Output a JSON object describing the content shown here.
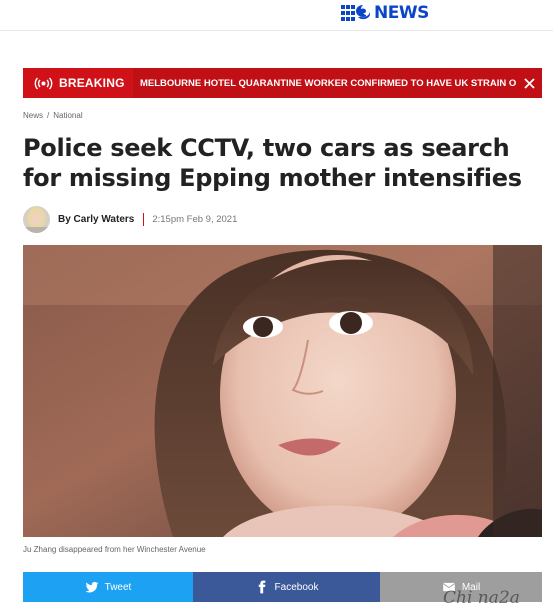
{
  "brand": {
    "logo_text": "NEWS",
    "primary_color": "#0b46c9"
  },
  "breaking": {
    "label": "BREAKING",
    "message": "MELBOURNE HOTEL QUARANTINE WORKER CONFIRMED TO HAVE UK STRAIN OF ...",
    "color": "#d01218"
  },
  "breadcrumb": {
    "items": [
      "News",
      "National"
    ],
    "separator": "/"
  },
  "article": {
    "headline": "Police seek CCTV, two cars as search for missing Epping mother intensifies",
    "author": "By Carly Waters",
    "timestamp": "2:15pm Feb 9, 2021",
    "image_caption": "Ju Zhang disappeared from her Winchester Avenue"
  },
  "share": {
    "tweet_label": "Tweet",
    "facebook_label": "Facebook",
    "mail_label": "Mail",
    "tweet_color": "#1da1f2",
    "facebook_color": "#3b5998",
    "mail_color": "#9e9e9e"
  },
  "watermark": {
    "text": "Chi na2a"
  },
  "icons": [
    "nine-logo-icon",
    "broadcast-icon",
    "close-icon",
    "twitter-icon",
    "facebook-icon",
    "mail-icon"
  ]
}
